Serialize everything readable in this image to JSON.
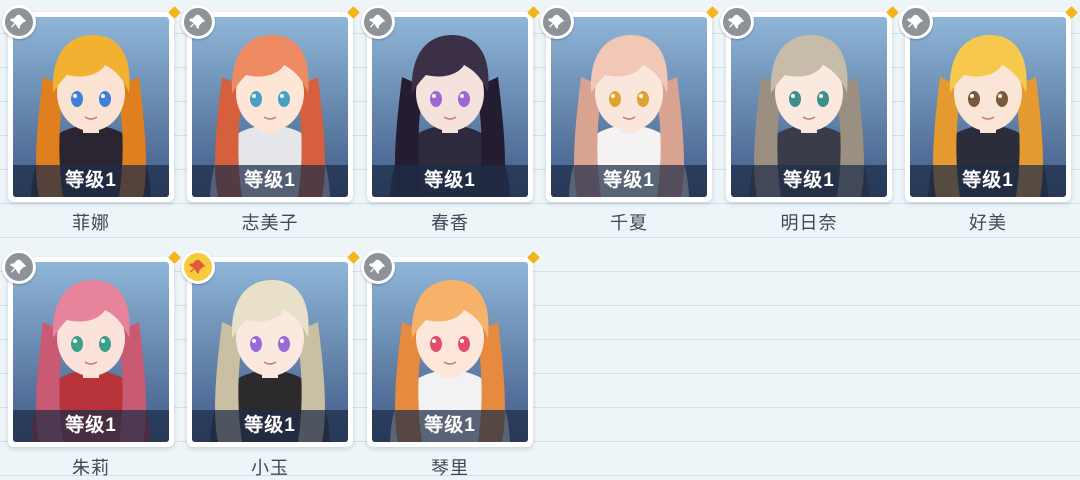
{
  "level_prefix": "等级",
  "characters": [
    {
      "name": "菲娜",
      "level": "等级1",
      "pinned": false,
      "hair": "#f3b132",
      "hair_dark": "#e07f1e",
      "skin": "#fbe3d3",
      "eye": "#3f7ed9",
      "bg_top": "#8fb6d8",
      "bg_bottom": "#3f5a86",
      "outfit": "#2a2530"
    },
    {
      "name": "志美子",
      "level": "等级1",
      "pinned": false,
      "hair": "#ee8b62",
      "hair_dark": "#d6603e",
      "skin": "#fde6d6",
      "eye": "#46a0c4",
      "bg_top": "#bfdbea",
      "bg_bottom": "#7ea7bf",
      "outfit": "#e4e6ea"
    },
    {
      "name": "春香",
      "level": "等级1",
      "pinned": false,
      "hair": "#3b3048",
      "hair_dark": "#241c30",
      "skin": "#f6e2dc",
      "eye": "#a065d4",
      "bg_top": "#3a3f6a",
      "bg_bottom": "#1e2140",
      "outfit": "#2e2a3e"
    },
    {
      "name": "千夏",
      "level": "等级1",
      "pinned": false,
      "hair": "#f1c8b6",
      "hair_dark": "#d9a392",
      "skin": "#fbe6dc",
      "eye": "#e0a22e",
      "bg_top": "#3c4b7a",
      "bg_bottom": "#222c50",
      "outfit": "#f4f2f2"
    },
    {
      "name": "明日奈",
      "level": "等级1",
      "pinned": false,
      "hair": "#c7bba9",
      "hair_dark": "#9a8f80",
      "skin": "#fbe8de",
      "eye": "#3f8f8a",
      "bg_top": "#5f7db0",
      "bg_bottom": "#2e426d",
      "outfit": "#3a3c4a"
    },
    {
      "name": "好美",
      "level": "等级1",
      "pinned": false,
      "hair": "#f6c84e",
      "hair_dark": "#e59a2f",
      "skin": "#fbe5d6",
      "eye": "#7a5a3a",
      "bg_top": "#e6eef4",
      "bg_bottom": "#b9cad8",
      "outfit": "#2b2d3a"
    },
    {
      "name": "朱莉",
      "level": "等级1",
      "pinned": false,
      "hair": "#e7839a",
      "hair_dark": "#c95a73",
      "skin": "#fbe3dc",
      "eye": "#3aa08a",
      "bg_top": "#8a2f3a",
      "bg_bottom": "#4a1a24",
      "outfit": "#b8333a"
    },
    {
      "name": "小玉",
      "level": "等级1",
      "pinned": true,
      "hair": "#e8e0c8",
      "hair_dark": "#c9bfa2",
      "skin": "#fbe9e0",
      "eye": "#9a6ad8",
      "bg_top": "#9fb5c8",
      "bg_bottom": "#5e7590",
      "outfit": "#2c2a2c"
    },
    {
      "name": "琴里",
      "level": "等级1",
      "pinned": false,
      "hair": "#f7b26a",
      "hair_dark": "#e58a3f",
      "skin": "#fde7da",
      "eye": "#e34c6a",
      "bg_top": "#2f4a8a",
      "bg_bottom": "#1a2a5a",
      "outfit": "#f2f2f4"
    }
  ]
}
